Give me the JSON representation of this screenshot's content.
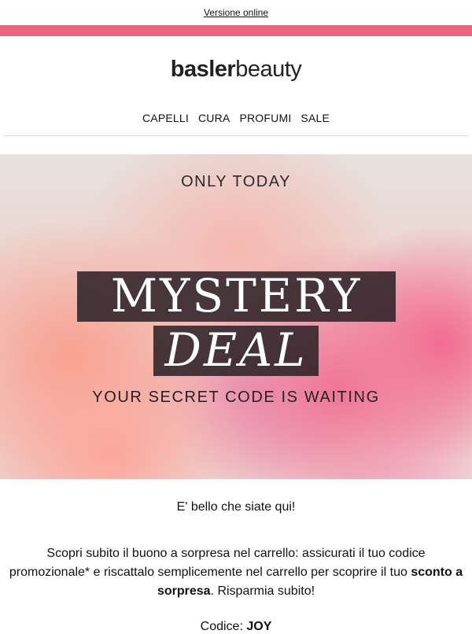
{
  "header": {
    "online_version_link": "Versione online",
    "brand_color": "#e9677e"
  },
  "logo": {
    "part_bold": "basler",
    "part_light": "beauty"
  },
  "nav": {
    "items": [
      "CAPELLI",
      "CURA",
      "PROFUMI",
      "SALE"
    ]
  },
  "hero": {
    "top_text": "ONLY TODAY",
    "headline_1": "MYSTERY",
    "headline_2": "DEAL",
    "bottom_text": "YOUR SECRET CODE IS WAITING"
  },
  "content": {
    "greeting": "E' bello che siate qui!",
    "message_pre": "Scopri subito il buono a sorpresa nel carrello: assicurati il tuo codice promozionale* e riscattalo semplicemente nel carrello per scoprire il tuo ",
    "message_bold": "sconto a sorpresa",
    "message_post": ". Risparmia subito!",
    "code_label": "Codice:",
    "code_value": "JOY"
  }
}
